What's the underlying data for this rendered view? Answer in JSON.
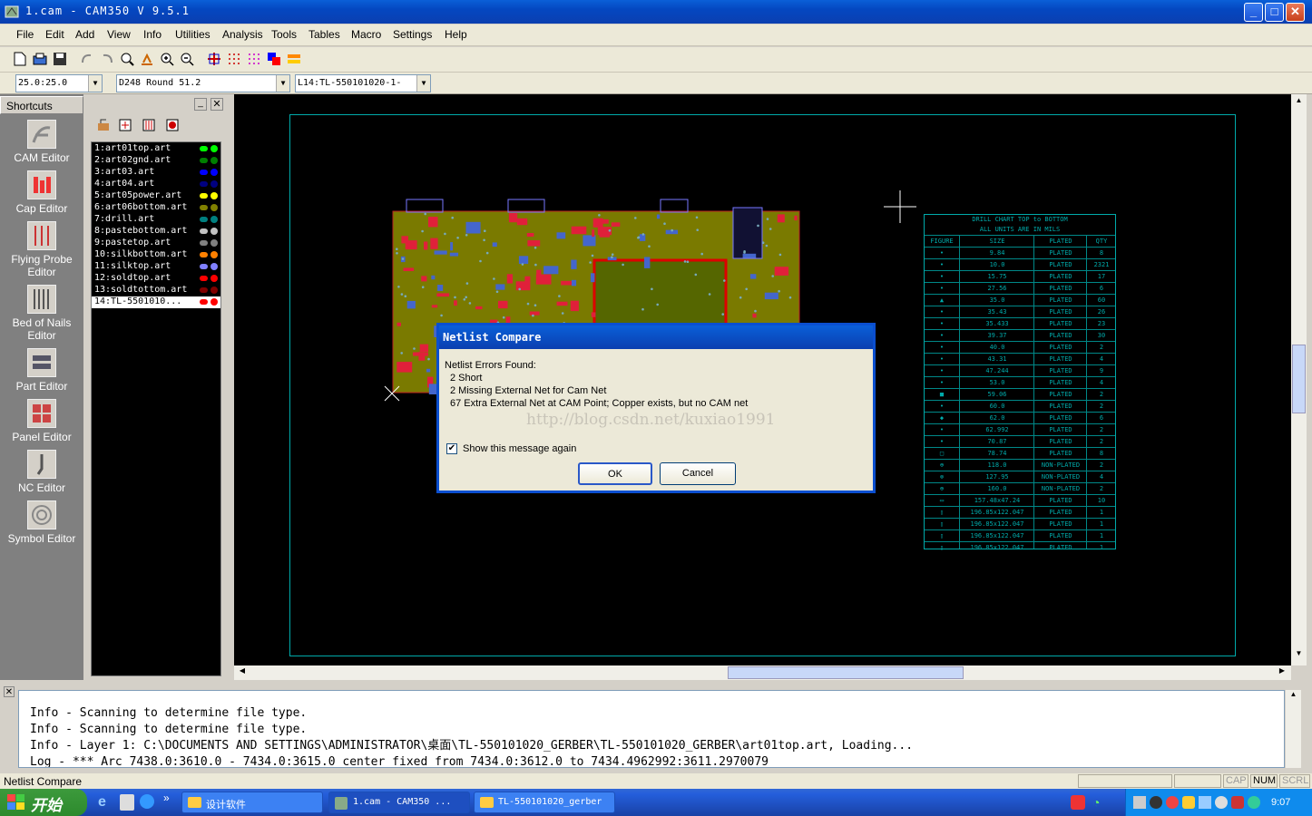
{
  "window": {
    "title": "1.cam - CAM350 V 9.5.1",
    "minimize": "_",
    "maximize": "□",
    "close": "✕"
  },
  "menu": [
    "File",
    "Edit",
    "Add",
    "View",
    "Info",
    "Utilities",
    "Analysis",
    "Tools",
    "Tables",
    "Macro",
    "Settings",
    "Help"
  ],
  "toolbar2": {
    "grid": "25.0:25.0",
    "dcode": "D248  Round 51.2",
    "layer": "L14:TL-550101020-1-"
  },
  "shortcuts": {
    "title": "Shortcuts",
    "items": [
      "CAM Editor",
      "Cap Editor",
      "Flying Probe Editor",
      "Bed of Nails Editor",
      "Part Editor",
      "Panel Editor",
      "NC Editor",
      "Symbol Editor"
    ]
  },
  "layers": [
    {
      "label": "1:art01top.art",
      "c1": "#00ff00",
      "c2": "#00ff00"
    },
    {
      "label": "2:art02gnd.art",
      "c1": "#008000",
      "c2": "#008000"
    },
    {
      "label": "3:art03.art",
      "c1": "#0000ff",
      "c2": "#0000ff"
    },
    {
      "label": "4:art04.art",
      "c1": "#000080",
      "c2": "#000080"
    },
    {
      "label": "5:art05power.art",
      "c1": "#ffff00",
      "c2": "#ffff00"
    },
    {
      "label": "6:art06bottom.art",
      "c1": "#808000",
      "c2": "#808000"
    },
    {
      "label": "7:drill.art",
      "c1": "#008080",
      "c2": "#008080"
    },
    {
      "label": "8:pastebottom.art",
      "c1": "#c0c0c0",
      "c2": "#c0c0c0"
    },
    {
      "label": "9:pastetop.art",
      "c1": "#808080",
      "c2": "#808080"
    },
    {
      "label": "10:silkbottom.art",
      "c1": "#ff8000",
      "c2": "#ff8000"
    },
    {
      "label": "11:silktop.art",
      "c1": "#8080ff",
      "c2": "#8080ff"
    },
    {
      "label": "12:soldtop.art",
      "c1": "#ff0000",
      "c2": "#ff0000"
    },
    {
      "label": "13:soldtottom.art",
      "c1": "#800000",
      "c2": "#800000"
    },
    {
      "label": "14:TL-5501010...",
      "c1": "#ff0000",
      "c2": "#ff0000",
      "selected": true
    }
  ],
  "drill_chart": {
    "title1": "DRILL CHART  TOP to BOTTOM",
    "title2": "ALL UNITS ARE IN MILS",
    "headers": [
      "FIGURE",
      "SIZE",
      "PLATED",
      "QTY"
    ],
    "rows": [
      [
        "•",
        "9.84",
        "PLATED",
        "8"
      ],
      [
        "•",
        "10.0",
        "PLATED",
        "2321"
      ],
      [
        "•",
        "15.75",
        "PLATED",
        "17"
      ],
      [
        "•",
        "27.56",
        "PLATED",
        "6"
      ],
      [
        "▲",
        "35.0",
        "PLATED",
        "60"
      ],
      [
        "•",
        "35.43",
        "PLATED",
        "26"
      ],
      [
        "•",
        "35.433",
        "PLATED",
        "23"
      ],
      [
        "•",
        "39.37",
        "PLATED",
        "30"
      ],
      [
        "•",
        "40.0",
        "PLATED",
        "2"
      ],
      [
        "•",
        "43.31",
        "PLATED",
        "4"
      ],
      [
        "•",
        "47.244",
        "PLATED",
        "9"
      ],
      [
        "•",
        "53.0",
        "PLATED",
        "4"
      ],
      [
        "■",
        "59.06",
        "PLATED",
        "2"
      ],
      [
        "•",
        "60.0",
        "PLATED",
        "2"
      ],
      [
        "◆",
        "62.0",
        "PLATED",
        "6"
      ],
      [
        "•",
        "62.992",
        "PLATED",
        "2"
      ],
      [
        "•",
        "70.87",
        "PLATED",
        "2"
      ],
      [
        "□",
        "78.74",
        "PLATED",
        "8"
      ],
      [
        "⊕",
        "118.0",
        "NON-PLATED",
        "2"
      ],
      [
        "⊗",
        "127.95",
        "NON-PLATED",
        "4"
      ],
      [
        "⊕",
        "160.0",
        "NON-PLATED",
        "2"
      ],
      [
        "▭",
        "157.48x47.24",
        "PLATED",
        "10"
      ],
      [
        "▯",
        "196.85x122.047",
        "PLATED",
        "1"
      ],
      [
        "▯",
        "196.85x122.047",
        "PLATED",
        "1"
      ],
      [
        "▯",
        "196.85x122.047",
        "PLATED",
        "1"
      ],
      [
        "▯",
        "196.85x122.047",
        "PLATED",
        "1"
      ]
    ]
  },
  "dialog": {
    "title": "Netlist Compare",
    "heading": "Netlist Errors Found:",
    "lines": [
      "2 Short",
      "2 Missing External Net for Cam Net",
      "67 Extra External Net at CAM Point; Copper exists, but no CAM net"
    ],
    "watermark": "http://blog.csdn.net/kuxiao1991",
    "checkbox_label": "Show this message again",
    "checkbox_checked": true,
    "ok": "OK",
    "cancel": "Cancel"
  },
  "log": [
    "Info - Scanning to determine file type.",
    "Info - Scanning to determine file type.",
    "Info - Layer 1: C:\\DOCUMENTS AND SETTINGS\\ADMINISTRATOR\\桌面\\TL-550101020_GERBER\\TL-550101020_GERBER\\art01top.art, Loading...",
    "Log - *** Arc 7438.0:3610.0 - 7434.0:3615.0 center fixed from 7434.0:3612.0 to 7434.4962992:3611.2970079"
  ],
  "status": {
    "text": "Netlist Compare",
    "cap": "CAP",
    "num": "NUM",
    "scrl": "SCRL"
  },
  "taskbar": {
    "start": "开始",
    "tasks": [
      "设计软件",
      "1.cam - CAM350 ...",
      "TL-550101020_gerber"
    ],
    "clock": "9:07"
  }
}
